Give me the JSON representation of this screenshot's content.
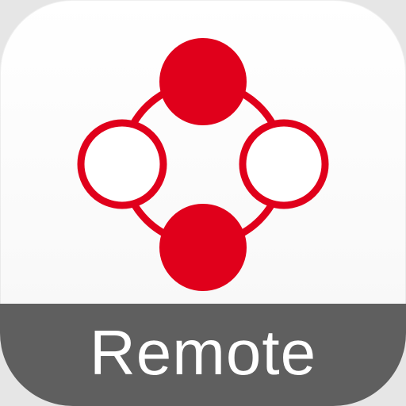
{
  "app": {
    "label": "Remote",
    "icon_name": "remote-controller-icon",
    "colors": {
      "accent": "#e0001b",
      "background": "#ffffff",
      "label_bar": "#5f5f5f",
      "label_text": "#ffffff"
    }
  }
}
